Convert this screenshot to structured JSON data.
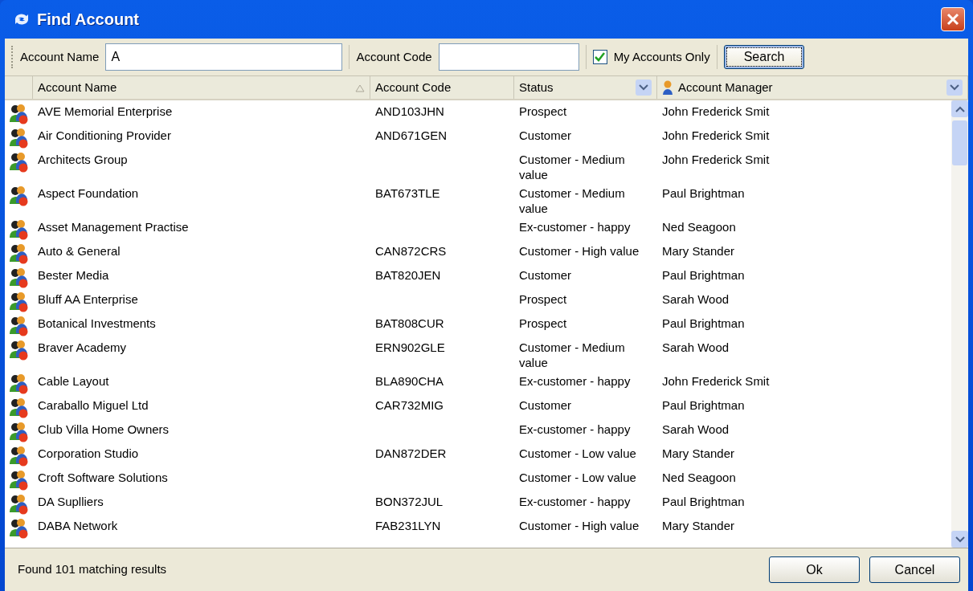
{
  "window": {
    "title": "Find Account"
  },
  "toolbar": {
    "fields": [
      {
        "label": "Account Name",
        "value": "A"
      },
      {
        "label": "Account Code"
      }
    ],
    "my_accounts_only": {
      "label": "My Accounts Only",
      "checked": true
    },
    "search_button": "Search"
  },
  "table": {
    "columns": [
      {
        "label": "Account Name",
        "sorted": true,
        "filter": false,
        "person_icon": false
      },
      {
        "label": "Account Code",
        "sorted": false,
        "filter": false,
        "person_icon": false
      },
      {
        "label": "Status",
        "sorted": false,
        "filter": true,
        "person_icon": false
      },
      {
        "label": "Account Manager",
        "sorted": false,
        "filter": true,
        "person_icon": true
      }
    ],
    "rows": [
      {
        "name": "AVE Memorial Enterprise",
        "code": "AND103JHN",
        "status": "Prospect",
        "manager": "John Frederick Smit"
      },
      {
        "name": "Air Conditioning Provider",
        "code": "AND671GEN",
        "status": "Customer",
        "manager": "John Frederick Smit"
      },
      {
        "name": "Architects Group",
        "status": "Customer - Medium value",
        "manager": "John Frederick Smit"
      },
      {
        "name": "Aspect Foundation",
        "code": "BAT673TLE",
        "status": "Customer - Medium value",
        "manager": "Paul Brightman"
      },
      {
        "name": "Asset Management Practise",
        "status": "Ex-customer - happy",
        "manager": "Ned Seagoon"
      },
      {
        "name": "Auto & General",
        "code": "CAN872CRS",
        "status": "Customer - High value",
        "manager": "Mary Stander"
      },
      {
        "name": "Bester Media",
        "code": "BAT820JEN",
        "status": "Customer",
        "manager": "Paul Brightman"
      },
      {
        "name": "Bluff AA Enterprise",
        "status": "Prospect",
        "manager": "Sarah Wood"
      },
      {
        "name": "Botanical Investments",
        "code": "BAT808CUR",
        "status": "Prospect",
        "manager": "Paul Brightman"
      },
      {
        "name": "Braver Academy",
        "code": "ERN902GLE",
        "status": "Customer - Medium value",
        "manager": "Sarah Wood"
      },
      {
        "name": "Cable Layout",
        "code": "BLA890CHA",
        "status": "Ex-customer - happy",
        "manager": "John Frederick Smit"
      },
      {
        "name": "Caraballo Miguel Ltd",
        "code": "CAR732MIG",
        "status": "Customer",
        "manager": "Paul Brightman"
      },
      {
        "name": "Club Villa Home Owners",
        "status": "Ex-customer - happy",
        "manager": "Sarah Wood"
      },
      {
        "name": "Corporation Studio",
        "code": "DAN872DER",
        "status": "Customer - Low value",
        "manager": "Mary Stander"
      },
      {
        "name": "Croft Software Solutions",
        "status": "Customer - Low value",
        "manager": "Ned Seagoon"
      },
      {
        "name": "DA Suplliers",
        "code": "BON372JUL",
        "status": "Ex-customer - happy",
        "manager": "Paul Brightman"
      },
      {
        "name": "DABA Network",
        "code": "FAB231LYN",
        "status": "Customer - High value",
        "manager": "Mary Stander"
      }
    ]
  },
  "status_bar": "Found 101 matching results",
  "buttons": [
    "Ok",
    "Cancel"
  ]
}
